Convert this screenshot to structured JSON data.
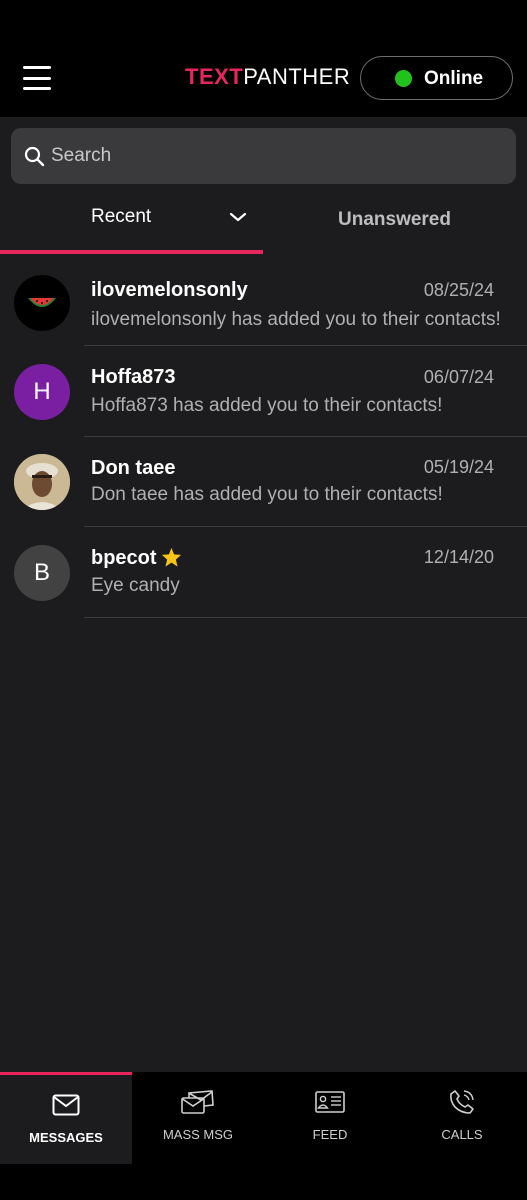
{
  "header": {
    "logo_part1": "TEXT",
    "logo_part2": "PANTHER",
    "status_label": "Online",
    "status_color": "#22c21e",
    "brand_color": "#e8265e"
  },
  "search": {
    "placeholder": "Search"
  },
  "tabs": [
    {
      "label": "Recent",
      "active": true
    },
    {
      "label": "Unanswered",
      "active": false
    }
  ],
  "conversations": [
    {
      "name": "ilovemelonsonly",
      "date": "08/25/24",
      "preview": "ilovemelonsonly has added you to their contacts!",
      "avatar": "watermelon-image"
    },
    {
      "name": "Hoffa873",
      "date": "06/07/24",
      "preview": "Hoffa873 has added you to their contacts!",
      "avatar_letter": "H",
      "avatar_color": "#7b1fa2"
    },
    {
      "name": "Don taee",
      "date": "05/19/24",
      "preview": "Don taee has added you to their contacts!",
      "avatar": "photo"
    },
    {
      "name": "bpecot",
      "date": "12/14/20",
      "preview": "Eye candy",
      "avatar_letter": "B",
      "avatar_color": "#424242",
      "starred": true
    }
  ],
  "bottom_nav": [
    {
      "label": "MESSAGES",
      "icon": "envelope-icon",
      "active": true
    },
    {
      "label": "MASS MSG",
      "icon": "mass-message-icon",
      "active": false
    },
    {
      "label": "FEED",
      "icon": "feed-card-icon",
      "active": false
    },
    {
      "label": "CALLS",
      "icon": "phone-icon",
      "active": false
    }
  ]
}
